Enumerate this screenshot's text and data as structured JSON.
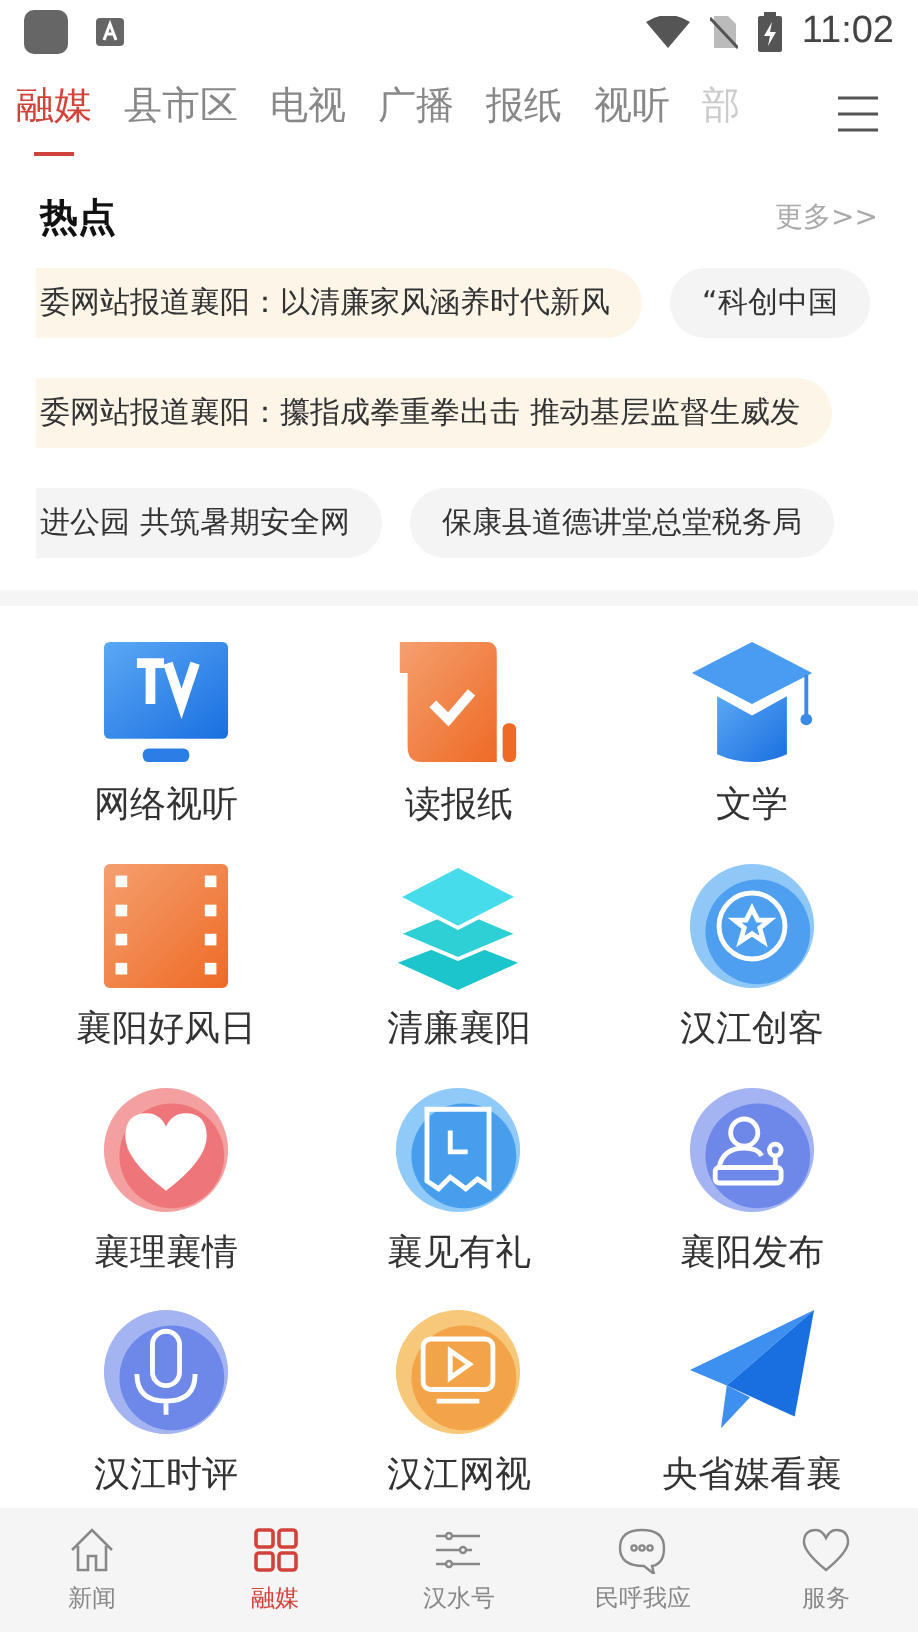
{
  "status_bar": {
    "time": "11:02"
  },
  "tabs": [
    {
      "label": "融媒",
      "selected": true
    },
    {
      "label": "县市区",
      "selected": false
    },
    {
      "label": "电视",
      "selected": false
    },
    {
      "label": "广播",
      "selected": false
    },
    {
      "label": "报纸",
      "selected": false
    },
    {
      "label": "视听",
      "selected": false
    },
    {
      "label": "部",
      "selected": false
    }
  ],
  "hot": {
    "title": "热点",
    "more": "更多>>",
    "rows": [
      [
        {
          "text": "委网站报道襄阳：以清廉家风涵养时代新风",
          "color": "#fdf6e8"
        },
        {
          "text": "“科创中国",
          "color": "#f4f4f4"
        }
      ],
      [
        {
          "text": "委网站报道襄阳：攥指成拳重拳出击 推动基层监督生威发",
          "color": "#fdf6e8"
        }
      ],
      [
        {
          "text": "进公园 共筑暑期安全网",
          "color": "#f4f4f4"
        },
        {
          "text": "保康县道德讲堂总堂税务局",
          "color": "#f4f4f4"
        }
      ]
    ]
  },
  "grid": [
    {
      "label": "网络视听",
      "kind": "tv"
    },
    {
      "label": "读报纸",
      "kind": "scroll"
    },
    {
      "label": "文学",
      "kind": "cap"
    },
    {
      "label": "襄阳好风日",
      "kind": "film"
    },
    {
      "label": "清廉襄阳",
      "kind": "layers"
    },
    {
      "label": "汉江创客",
      "kind": "star"
    },
    {
      "label": "襄理襄情",
      "kind": "heart"
    },
    {
      "label": "襄见有礼",
      "kind": "receipt"
    },
    {
      "label": "襄阳发布",
      "kind": "speaker"
    },
    {
      "label": "汉江时评",
      "kind": "mic"
    },
    {
      "label": "汉江网视",
      "kind": "video"
    },
    {
      "label": "央省媒看襄",
      "kind": "plane"
    }
  ],
  "nav": [
    {
      "label": "新闻",
      "kind": "home",
      "selected": false
    },
    {
      "label": "融媒",
      "kind": "grid",
      "selected": true
    },
    {
      "label": "汉水号",
      "kind": "sliders",
      "selected": false
    },
    {
      "label": "民呼我应",
      "kind": "chat",
      "selected": false
    },
    {
      "label": "服务",
      "kind": "heart",
      "selected": false
    }
  ]
}
